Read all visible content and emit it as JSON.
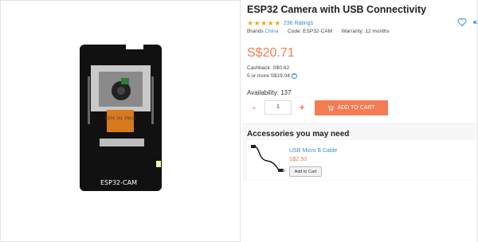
{
  "product": {
    "title": "ESP32 Camera with USB Connectivity",
    "rating_stars": "★★★★★",
    "rating_value": 5,
    "rating_count": "236 Ratings",
    "brands_label": "Brands",
    "brand": "China",
    "code": "Code: ESP32-CAM",
    "warranty": "Warranty: 12 months",
    "price": "S$20.71",
    "cashback": "Cashback: S$0.62",
    "bulk_price": "5 or more S$19.04",
    "availability": "Availability: 137",
    "board_label": "ESP32-CAM",
    "chip_text": "B2258 3V3 IT0328"
  },
  "cart": {
    "minus": "-",
    "quantity": "1",
    "plus": "+",
    "add_to_cart": "ADD TO CART"
  },
  "accessories": {
    "heading": "Accessories you may need",
    "items": [
      {
        "name": "USB Micro B Cable",
        "price": "S$2.50",
        "button": "Add to Cart"
      }
    ]
  },
  "icons": {
    "wishlist": "heart-icon",
    "share": "share-icon",
    "cart": "cart-icon",
    "expand": "plus-circle-icon"
  },
  "colors": {
    "accent": "#f47b52",
    "link": "#3a8fd9",
    "star": "#f5a623"
  }
}
